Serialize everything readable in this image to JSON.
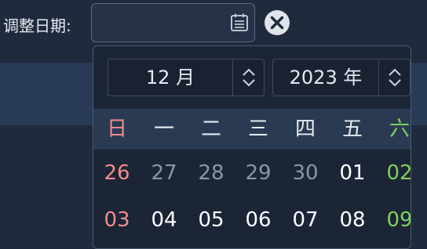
{
  "form": {
    "label": "调整日期:",
    "date_value": ""
  },
  "icons": {
    "calendar": "calendar-icon",
    "clear": "close-circle-icon",
    "spinner": "chevron-up-down-icon"
  },
  "picker": {
    "month": "12 月",
    "year": "2023 年",
    "weekdays": [
      "日",
      "一",
      "二",
      "三",
      "四",
      "五",
      "六"
    ],
    "rows": [
      [
        "26",
        "27",
        "28",
        "29",
        "30",
        "01",
        "02"
      ],
      [
        "03",
        "04",
        "05",
        "06",
        "07",
        "08",
        "09"
      ]
    ]
  },
  "colors": {
    "sunday": "#f08c8c",
    "saturday": "#7dd35a",
    "outside_month": "#8b95a3",
    "header_band": "#2a3a52"
  }
}
